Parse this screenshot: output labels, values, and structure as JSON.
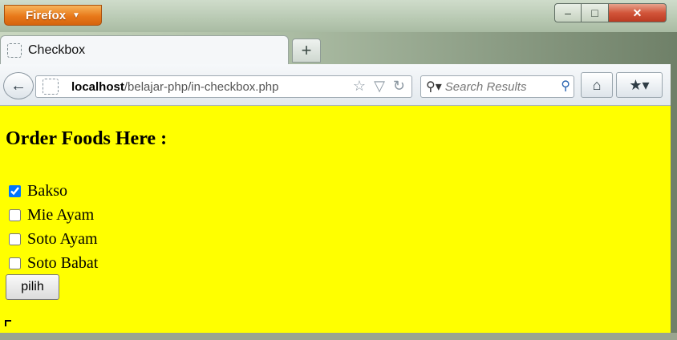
{
  "window": {
    "app_button_label": "Firefox",
    "controls": {
      "minimize": "–",
      "maximize": "□",
      "close": "✕"
    }
  },
  "tabs": [
    {
      "label": "Checkbox"
    }
  ],
  "newtab_label": "+",
  "navbar": {
    "back_icon": "←",
    "url_host": "localhost",
    "url_path": "/belajar-php/in-checkbox.php",
    "search_placeholder": "Search Results"
  },
  "page": {
    "heading": "Order Foods Here :",
    "options": [
      {
        "label": "Bakso",
        "checked": true
      },
      {
        "label": "Mie Ayam",
        "checked": false
      },
      {
        "label": "Soto Ayam",
        "checked": false
      },
      {
        "label": "Soto Babat",
        "checked": false
      }
    ],
    "submit_label": "pilih",
    "background": "#ffff00"
  }
}
